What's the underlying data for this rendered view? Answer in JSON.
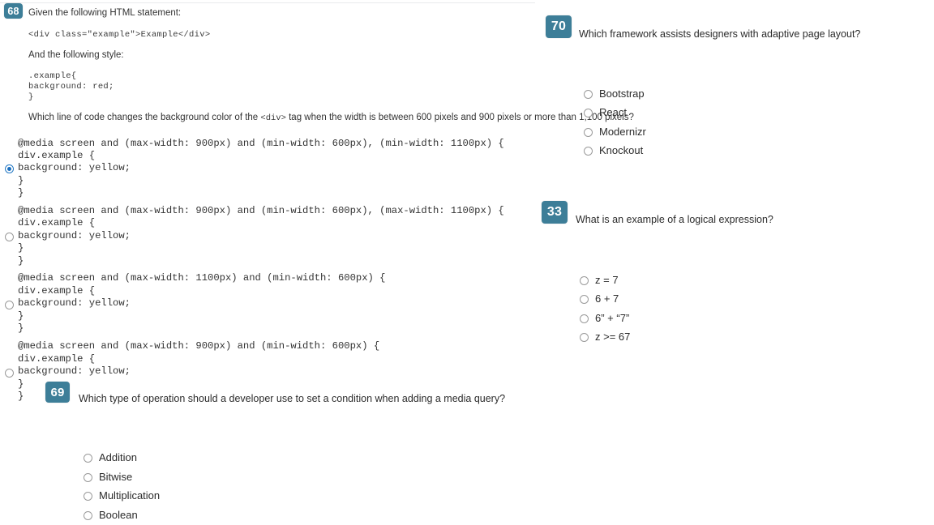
{
  "theme": {
    "badge_bg": "#3d7e98",
    "badge_text": "#ffffff",
    "radio_selected": "#1b6fc0",
    "page_bg": "#ffffff",
    "text": "#2b2b2b"
  },
  "questions": [
    {
      "number": "68",
      "stem_lines": [
        "Given the following HTML statement:",
        "And the following style:"
      ],
      "code_sample": "<div class=\"example\">Example</div>",
      "style_sample_lines": [
        ".example{",
        "background: red;",
        "}"
      ],
      "prompt_prefix": "Which line of code changes the background color of the ",
      "prompt_inline_code": "<div>",
      "prompt_suffix": " tag when the width is between 600 pixels and 900 pixels or more than 1,100 pixels?",
      "options": [
        {
          "selected": true,
          "lines": [
            "@media screen and (max-width: 900px) and (min-width: 600px), (min-width: 1100px) {",
            "div.example {",
            "background: yellow;",
            "}",
            "}"
          ]
        },
        {
          "selected": false,
          "lines": [
            "@media screen and (max-width: 900px) and (min-width: 600px), (max-width: 1100px) {",
            "div.example {",
            "background: yellow;",
            "}",
            "}"
          ]
        },
        {
          "selected": false,
          "lines": [
            "@media screen and (max-width: 1100px) and (min-width: 600px) {",
            "div.example {",
            "background: yellow;",
            "}",
            "}"
          ]
        },
        {
          "selected": false,
          "lines": [
            "@media screen and (max-width: 900px) and (min-width: 600px) {",
            "div.example {",
            "background: yellow;",
            "}",
            "}"
          ]
        }
      ]
    },
    {
      "number": "69",
      "text": "Which type of operation should a developer use to set a condition when adding a media query?",
      "options": [
        {
          "label": "Addition",
          "selected": false
        },
        {
          "label": "Bitwise",
          "selected": false
        },
        {
          "label": "Multiplication",
          "selected": false
        },
        {
          "label": "Boolean",
          "selected": false
        }
      ]
    },
    {
      "number": "70",
      "text": "Which framework assists designers with adaptive page layout?",
      "options": [
        {
          "label": "Bootstrap",
          "selected": false
        },
        {
          "label": "React",
          "selected": false
        },
        {
          "label": "Modernizr",
          "selected": false
        },
        {
          "label": "Knockout",
          "selected": false
        }
      ]
    },
    {
      "number": "33",
      "text": "What is an example of a logical expression?",
      "options": [
        {
          "label": "z = 7",
          "selected": false
        },
        {
          "label": "6 + 7",
          "selected": false
        },
        {
          "label": "6” + “7”",
          "selected": false
        },
        {
          "label": "z >= 67",
          "selected": false
        }
      ]
    }
  ]
}
